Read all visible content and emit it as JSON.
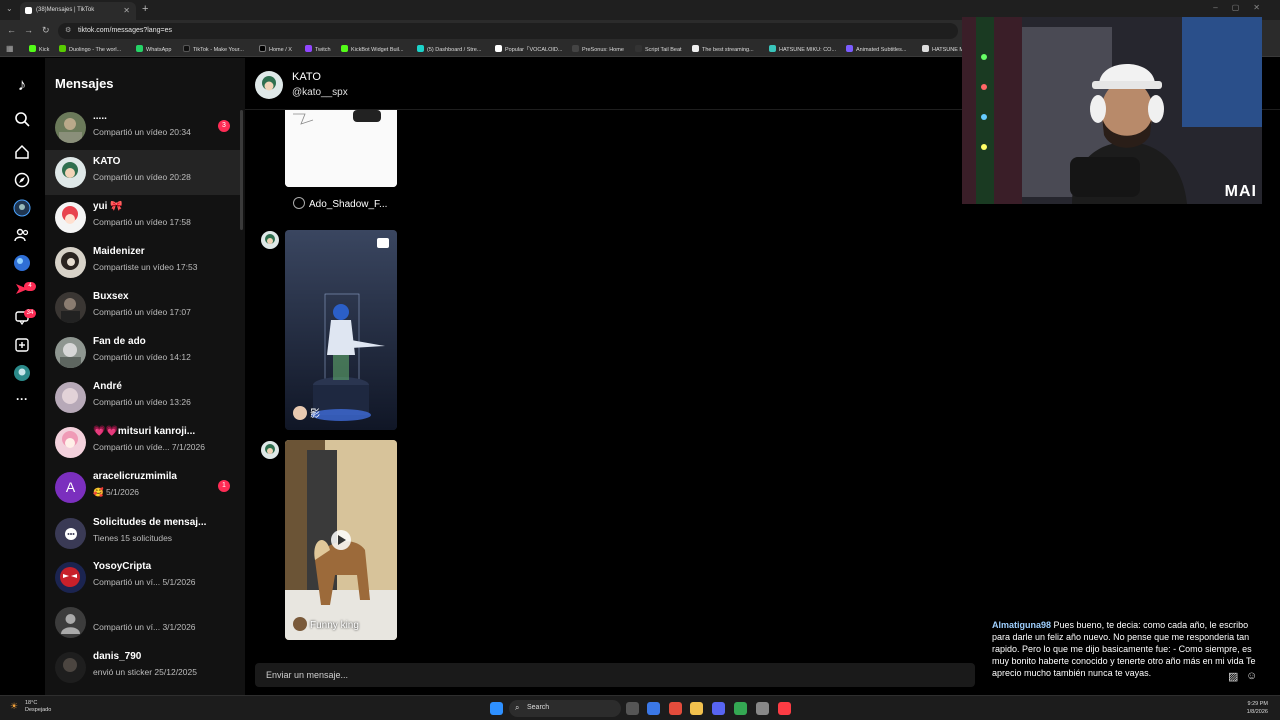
{
  "browser": {
    "tab_title": "(38)Mensajes | TikTok",
    "url": "tiktok.com/messages?lang=es",
    "bookmarks": [
      "Kick",
      "Duolingo - The worl...",
      "WhatsApp",
      "TikTok - Make Your...",
      "Home / X",
      "Twitch",
      "KickBot Widget Buil...",
      "(5) Dashboard / Stre...",
      "Popular「VOCALOID...",
      "PreSonus: Home",
      "Script Tail Beat",
      "The best streaming...",
      "HATSUNE MIKU: CO...",
      "Animated Subtitles...",
      "HATSUNE M"
    ]
  },
  "rail": {
    "notifications_badge": "4",
    "inbox_badge": "34"
  },
  "sidebar": {
    "title": "Mensajes",
    "conversations": [
      {
        "name": ".....",
        "message": "Compartió un vídeo 20:34",
        "badge": "3"
      },
      {
        "name": "KATO",
        "message": "Compartió un vídeo 20:28",
        "badge": ""
      },
      {
        "name": "yui 🎀",
        "message": "Compartió un vídeo 17:58",
        "badge": ""
      },
      {
        "name": "Maidenizer",
        "message": "Compartiste un vídeo 17:53",
        "badge": ""
      },
      {
        "name": "Buxsex",
        "message": "Compartió un vídeo 17:07",
        "badge": ""
      },
      {
        "name": "Fan de ado",
        "message": "Compartió un vídeo 14:12",
        "badge": ""
      },
      {
        "name": "André",
        "message": "Compartió un vídeo 13:26",
        "badge": ""
      },
      {
        "name": "💗💗mitsuri kanroji...",
        "message": "Compartió un víde... 7/1/2026",
        "badge": ""
      },
      {
        "name": "aracelicruzmimila",
        "message": "🥰 5/1/2026",
        "badge": "1"
      },
      {
        "name": "Solicitudes de mensaj...",
        "message": "Tienes 15 solicitudes",
        "badge": ""
      },
      {
        "name": "YosoyCripta",
        "message": "Compartió un ví... 5/1/2026",
        "badge": ""
      },
      {
        "name": "",
        "message": "Compartió un ví... 3/1/2026",
        "badge": ""
      },
      {
        "name": "danis_790",
        "message": "envió un sticker 25/12/2025",
        "badge": ""
      }
    ]
  },
  "chat": {
    "name": "KATO",
    "handle": "@kato__spx",
    "cards": [
      {
        "caption": "Ado_Shadow_F..."
      },
      {
        "caption": "影"
      },
      {
        "caption": "Funny king"
      }
    ],
    "composer_placeholder": "Enviar un mensaje..."
  },
  "webcam": {
    "label": "MAI"
  },
  "stream_chat": {
    "user": "Almatiguna98",
    "message": "Pues bueno, te decia: como cada año, le escribo para darle un feliz año nuevo. No pense que me responderia tan rapido. Pero lo que me dijo basicamente fue: - Como siempre, es muy bonito haberte conocido y tenerte otro año más en mi vida Te aprecio mucho también nunca te vayas."
  },
  "taskbar": {
    "weather_temp": "18°C",
    "weather_desc": "Despejado",
    "search_label": "Search",
    "time": "9:29 PM",
    "date": "1/8/2026"
  }
}
